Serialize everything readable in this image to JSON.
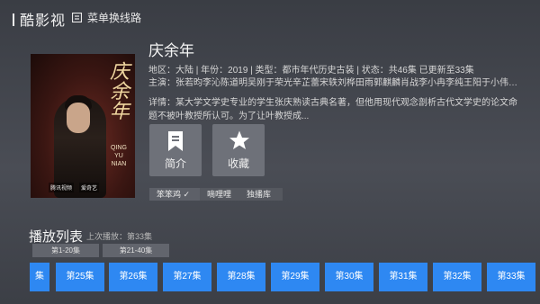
{
  "app": {
    "title": "酷影视"
  },
  "switch_line": {
    "label": "菜单换线路"
  },
  "poster": {
    "calligraphy": "庆余年",
    "english": "QING YU NIAN",
    "logos": [
      "腾讯视频",
      "爱奇艺"
    ]
  },
  "show": {
    "title": "庆余年",
    "meta": "地区：大陆 | 年份：2019 | 类型：都市年代历史古装 | 状态：共46集 已更新至33集",
    "cast": "主演：张若昀李沁陈道明吴刚于荣光辛芷蕾宋轶刘桦田雨郭麒麟肖战李小冉李纯王阳于小伟刘美彤韩...",
    "desc": "详情：某大学文学史专业的学生张庆熟读古典名著，但他用现代观念剖析古代文学史的论文命题不被叶教授所认可。为了让叶教授成..."
  },
  "actions": {
    "intro_label": "简介",
    "fav_label": "收藏"
  },
  "sources": [
    "笨笨鸡 ✓",
    "嘀哩哩",
    "独播库"
  ],
  "playlist": {
    "title": "播放列表",
    "last_played": "上次播放：第33集",
    "ranges": [
      "第1-20集",
      "第21-40集"
    ],
    "episodes": [
      "集",
      "第25集",
      "第26集",
      "第27集",
      "第28集",
      "第29集",
      "第30集",
      "第31集",
      "第32集",
      "第33集"
    ]
  },
  "colors": {
    "accent": "#2e88f2",
    "background": "#45484f"
  }
}
